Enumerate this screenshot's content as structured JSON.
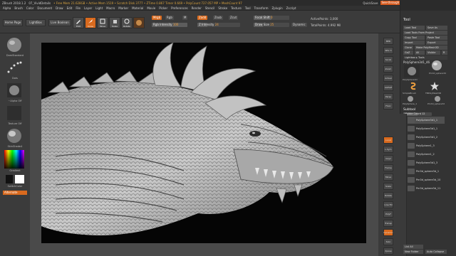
{
  "titlebar": {
    "app": "ZBrush 2018.1.2",
    "doc": "07_VividDetails",
    "stats": "• Free Mem 21.628GB • Active Mem 1519 • Scratch Disk 3777 • ZTime 0.867 Timer 0.669 • PolyCount 727.057 MP • MeshCount 97",
    "quicksave": "QuickSave",
    "seethrough": "See-through 0",
    "menus": "Menus",
    "defaultscript": "DefaultZScript"
  },
  "menubar": [
    "Alpha",
    "Brush",
    "Color",
    "Document",
    "Draw",
    "Edit",
    "File",
    "Layer",
    "Light",
    "Macro",
    "Marker",
    "Material",
    "Movie",
    "Picker",
    "Preferences",
    "Render",
    "Stencil",
    "Stroke",
    "Texture",
    "Tool",
    "Transform",
    "Zplugin",
    "Zscript"
  ],
  "shelf": {
    "home_page": "Home Page",
    "lightbox": "LightBox",
    "live_boolean": "Live Boolean",
    "edit": "Edit",
    "draw": "Draw",
    "move": "Move",
    "scale": "Scale",
    "rotate": "Rotate",
    "mrgb": "Mrgb",
    "rgb": "Rgb",
    "m": "M",
    "zadd": "Zadd",
    "zsub": "Zsub",
    "zcut": "Zcut",
    "rgb_intensity": "Rgb Intensity",
    "rgb_intensity_value": "100",
    "z_intensity": "Z Intensity",
    "z_intensity_value": "24",
    "focal_shift": "Focal Shift",
    "focal_shift_value": "0",
    "draw_size": "Draw Size",
    "draw_size_value": "25",
    "dynamic": "Dynamic",
    "active_points": "ActivePoints: 3,000",
    "total_points": "TotalPoints: 4.992 Mil"
  },
  "lefttray": {
    "brush_label": "DamStandard",
    "stroke_label": "Dots",
    "alpha_label": "~Alpha Off",
    "texture_label": "Texture Off",
    "material_label": "SkinShade4",
    "gradient_label": "Gradient",
    "switch_color": "SwitchColor",
    "alternate": "Alternate"
  },
  "rightstrip": [
    "BPR",
    "SPix 3",
    "Scroll",
    "Zoom",
    "Actual",
    "AAHalf",
    "Persp",
    "Floor",
    "Local",
    "L.Sym",
    "Gxyz",
    "Frame",
    "Move",
    "Scale",
    "Rotate",
    "Line Fill",
    "PolyF",
    "Transp",
    "Dynamic",
    "Solo",
    "Xpose"
  ],
  "toolpanel": {
    "header": "Tool",
    "load_tool": "Load Tool",
    "save_as": "Save As",
    "load_from_project": "Load Tools From Project",
    "copy_tool": "Copy Tool",
    "paste_tool": "Paste Tool",
    "import": "Import",
    "export": "Export",
    "clone": "Clone",
    "make_polymesh": "Make PolyMesh3D",
    "goz": "GoZ",
    "all": "All",
    "visible": "Visible",
    "r": "R",
    "lightbox_tools": "Lightbox ▸ Tools",
    "current_tool": "PolySphere3d1_46",
    "thumbs": [
      "PolySphere3d",
      "Pm3d_sphere3d",
      "SimpleBrush",
      "TBPolyMesh3D",
      "PolySphere_1",
      "Pm3d_sphere3d"
    ],
    "subtool_header": "Subtool",
    "visible_count": "Visible Count 12",
    "subtools": [
      "PolySphere3d1_1",
      "PolySphere3d1_1",
      "PolySphere3d1_2",
      "PolySphere1_3",
      "PolySphere1_2",
      "PolySphere3d1_3",
      "Pm3d_sphere3d_1",
      "Pm3d_sphere3d_10",
      "Pm3d_sphere3d_11"
    ],
    "list_all": "List All",
    "new_folder": "New Folder",
    "auto_collapse": "Auto Collapse"
  },
  "colors": {
    "accent": "#d96a1e",
    "highlight_text": "#f0a040",
    "panel": "#3b3b3b",
    "canvas": "#050505"
  }
}
